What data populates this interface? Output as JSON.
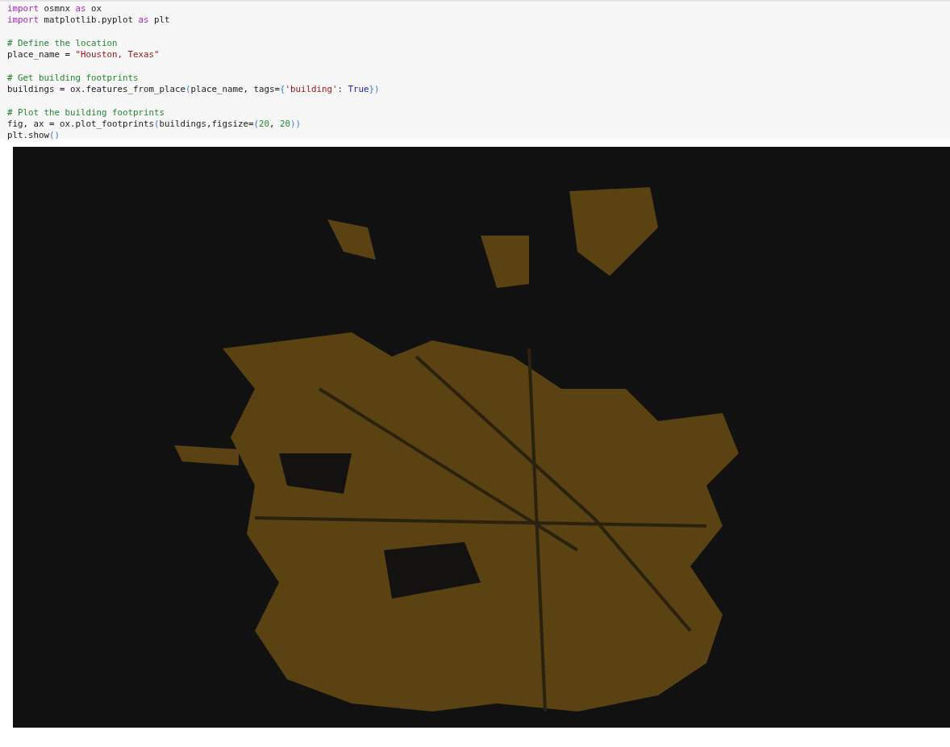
{
  "code_cell": {
    "lines": [
      {
        "kind": "code",
        "tokens": [
          {
            "kind": "keyword",
            "text": "import"
          },
          {
            "kind": "plain",
            "text": " osmnx "
          },
          {
            "kind": "keyword",
            "text": "as"
          },
          {
            "kind": "plain",
            "text": " ox"
          }
        ]
      },
      {
        "kind": "code",
        "tokens": [
          {
            "kind": "keyword",
            "text": "import"
          },
          {
            "kind": "plain",
            "text": " matplotlib.pyplot "
          },
          {
            "kind": "keyword",
            "text": "as"
          },
          {
            "kind": "plain",
            "text": " plt"
          }
        ]
      },
      {
        "kind": "blank"
      },
      {
        "kind": "code",
        "tokens": [
          {
            "kind": "comment",
            "text": "# Define the location"
          }
        ]
      },
      {
        "kind": "code",
        "tokens": [
          {
            "kind": "plain",
            "text": "place_name = "
          },
          {
            "kind": "string",
            "text": "\"Houston, Texas\""
          }
        ]
      },
      {
        "kind": "blank"
      },
      {
        "kind": "code",
        "tokens": [
          {
            "kind": "comment",
            "text": "# Get building footprints"
          }
        ]
      },
      {
        "kind": "code",
        "tokens": [
          {
            "kind": "plain",
            "text": "buildings = ox.features_from_place"
          },
          {
            "kind": "bracket",
            "text": "("
          },
          {
            "kind": "plain",
            "text": "place_name, tags="
          },
          {
            "kind": "bracket",
            "text": "{"
          },
          {
            "kind": "string",
            "text": "'building'"
          },
          {
            "kind": "plain",
            "text": ": "
          },
          {
            "kind": "constant",
            "text": "True"
          },
          {
            "kind": "bracket",
            "text": "})"
          }
        ]
      },
      {
        "kind": "blank"
      },
      {
        "kind": "code",
        "tokens": [
          {
            "kind": "comment",
            "text": "# Plot the building footprints"
          }
        ]
      },
      {
        "kind": "code",
        "tokens": [
          {
            "kind": "plain",
            "text": "fig, ax = ox.plot_footprints"
          },
          {
            "kind": "bracket",
            "text": "("
          },
          {
            "kind": "plain",
            "text": "buildings,figsize="
          },
          {
            "kind": "bracket",
            "text": "("
          },
          {
            "kind": "number",
            "text": "20"
          },
          {
            "kind": "plain",
            "text": ", "
          },
          {
            "kind": "number",
            "text": "20"
          },
          {
            "kind": "bracket",
            "text": "))"
          }
        ]
      },
      {
        "kind": "code",
        "tokens": [
          {
            "kind": "plain",
            "text": "plt.show"
          },
          {
            "kind": "bracket",
            "text": "()"
          }
        ]
      }
    ]
  }
}
